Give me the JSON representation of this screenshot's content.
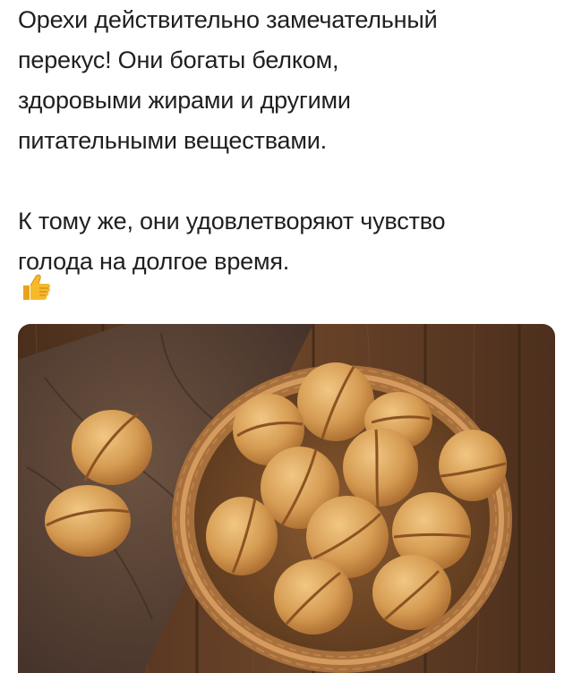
{
  "post": {
    "paragraph_1": {
      "line_1": "Орехи действительно замечательный",
      "line_2": "перекус! Они богаты белком,",
      "line_3": "здоровыми жирами и другими",
      "line_4": "питательными веществами."
    },
    "paragraph_2": {
      "line_1": "К тому же, они удовлетворяют чувство",
      "line_2": "голода на долгое время."
    },
    "emoji": "thumbs-up-icon",
    "image": {
      "subject": "walnut-shaped-cookies-in-basket"
    }
  },
  "colors": {
    "text": "#1f1f1f",
    "wood": "#5a3a24",
    "cloth": "#5e4636",
    "basket": "#b07a45",
    "cookie": "#d9a25a"
  }
}
